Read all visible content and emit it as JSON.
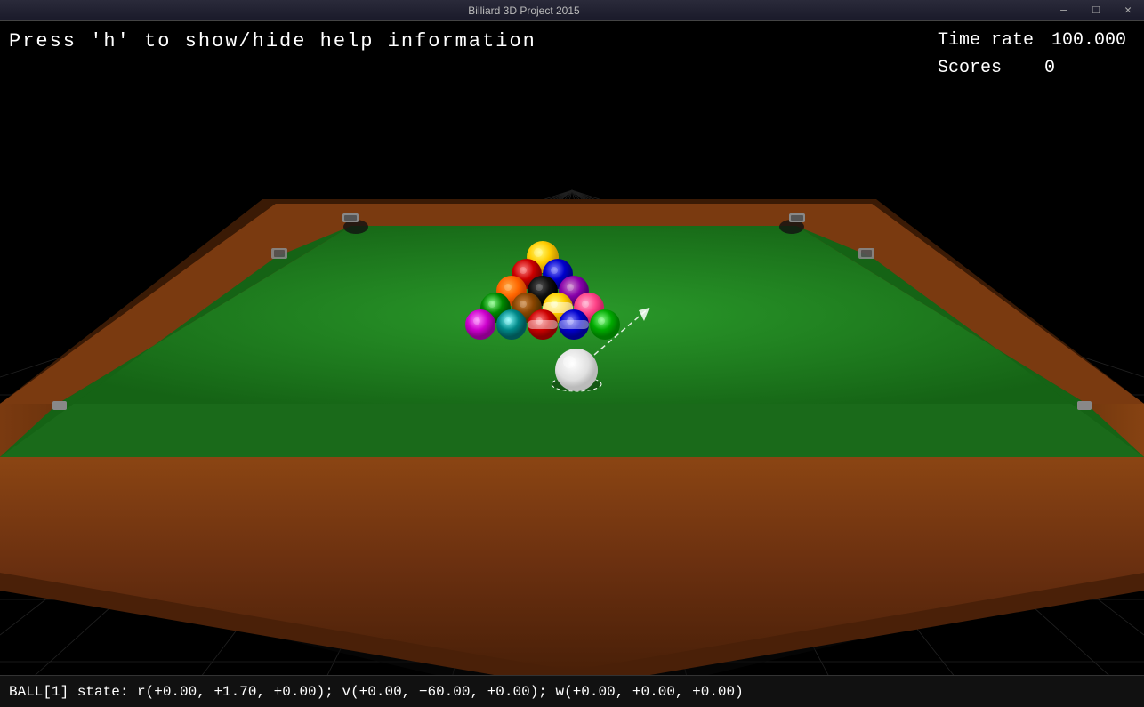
{
  "titlebar": {
    "title": "Billiard 3D Project 2015",
    "controls": {
      "minimize": "—",
      "maximize": "□",
      "close": "✕"
    }
  },
  "hud": {
    "help_text": "Press 'h' to show/hide help information",
    "time_rate_label": "Time rate",
    "time_rate_value": "100.000",
    "scores_label": "Scores",
    "scores_value": "0"
  },
  "statusbar": {
    "text": "BALL[1] state: r(+0.00, +1.70, +0.00); v(+0.00, −60.00, +0.00); w(+0.00, +0.00, +0.00)"
  },
  "colors": {
    "table_green": "#1a7a1a",
    "table_felt": "#1e8b1e",
    "table_border": "#6b3a1f",
    "table_dark_border": "#4a2510",
    "floor": "#111",
    "background": "#000"
  }
}
